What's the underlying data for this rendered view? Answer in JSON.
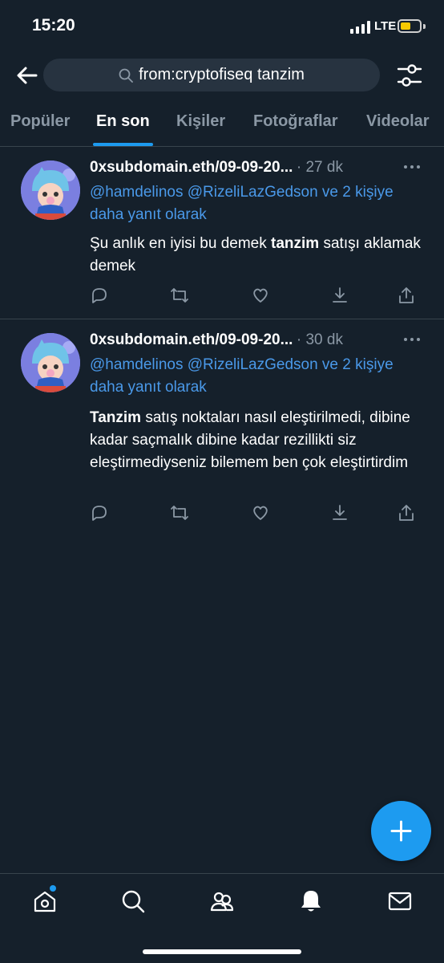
{
  "status_bar": {
    "time": "15:20",
    "network": "LTE"
  },
  "search": {
    "query": "from:cryptofiseq tanzim"
  },
  "tabs": [
    "Popüler",
    "En son",
    "Kişiler",
    "Fotoğraflar",
    "Videolar"
  ],
  "active_tab": "En son",
  "tweets": [
    {
      "author": "0xsubdomain.eth/09-09-20...",
      "time": "· 27 dk",
      "reply_to": "@hamdelinos @RizeliLazGedson ve 2 kişiye daha yanıt olarak",
      "body_parts": [
        {
          "text": "Şu anlık en iyisi bu demek ",
          "bold": false
        },
        {
          "text": "tanzim",
          "bold": true
        },
        {
          "text": " satışı aklamak demek",
          "bold": false
        }
      ]
    },
    {
      "author": "0xsubdomain.eth/09-09-20...",
      "time": "· 30 dk",
      "reply_to": "@hamdelinos @RizeliLazGedson ve 2 kişiye daha yanıt olarak",
      "body_parts": [
        {
          "text": "Tanzim",
          "bold": true
        },
        {
          "text": " satış noktaları nasıl eleştirilmedi, dibine kadar saçmalık dibine kadar rezillikti siz eleştirmediyseniz bilemem ben çok eleştirtirdim",
          "bold": false
        }
      ]
    }
  ],
  "icons": {
    "back": "arrow-left-icon",
    "search": "search-icon",
    "filter": "sliders-icon",
    "more": "more-dots-icon",
    "reply": "reply-icon",
    "retweet": "retweet-icon",
    "like": "heart-icon",
    "bookmark": "bookmark-download-icon",
    "share": "share-icon",
    "compose": "plus-icon",
    "nav": [
      "home-icon",
      "search-icon",
      "communities-icon",
      "notifications-bell-icon",
      "messages-icon"
    ]
  },
  "colors": {
    "background": "#15202b",
    "accent": "#1d9bf0",
    "link": "#4a99e9",
    "muted": "#8b98a5",
    "divider": "#38444d",
    "battery": "#f7c900"
  }
}
